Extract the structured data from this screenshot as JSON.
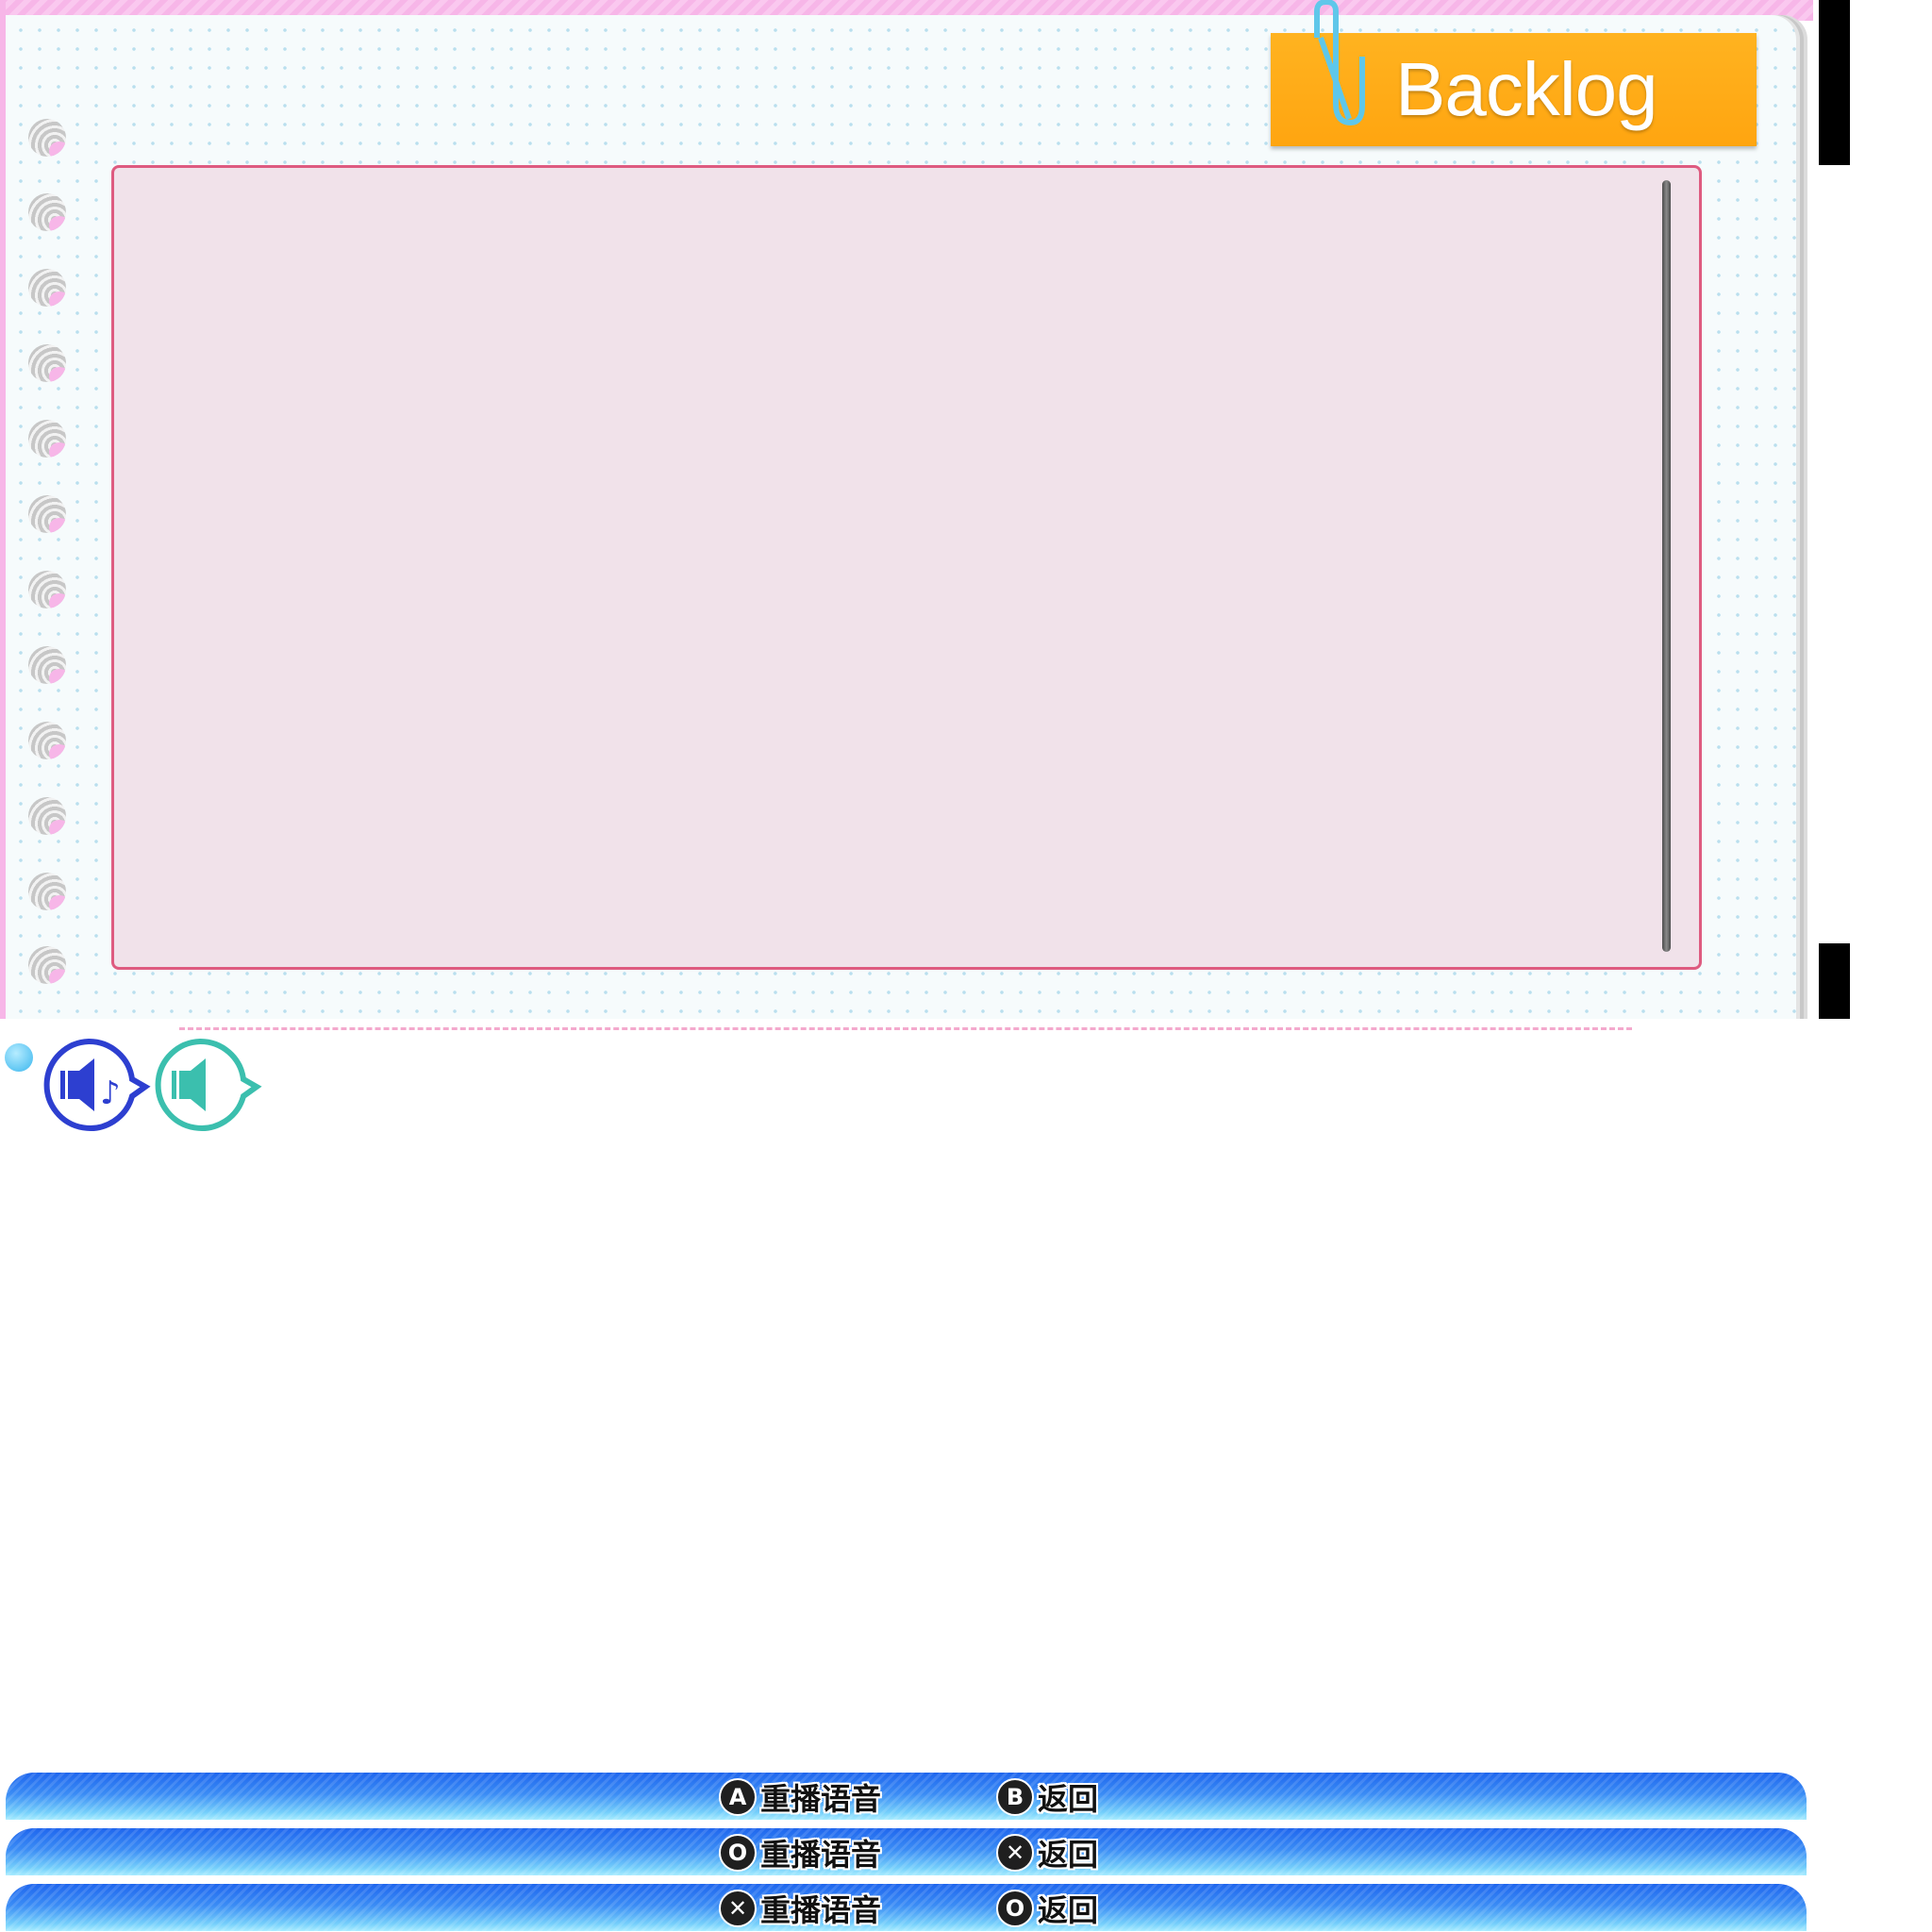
{
  "window": {
    "title": "Backlog"
  },
  "log": {
    "entries": []
  },
  "voice_buttons": [
    {
      "icon": "speaker-music-icon",
      "color": "#2d3fd0"
    },
    {
      "icon": "speaker-icon",
      "color": "#3bbfae"
    }
  ],
  "controls": [
    {
      "confirm_glyph": "A",
      "confirm_label": "重播语音",
      "back_glyph": "B",
      "back_label": "返回"
    },
    {
      "confirm_glyph": "O",
      "confirm_label": "重播语音",
      "back_glyph": "✕",
      "back_label": "返回"
    },
    {
      "confirm_glyph": "✕",
      "confirm_label": "重播语音",
      "back_glyph": "O",
      "back_label": "返回"
    }
  ],
  "colors": {
    "tag": "#ffab14",
    "panel_bg": "#f1e2ea",
    "panel_border": "#de5b80",
    "bar_gradient_top": "#1f66ee",
    "bar_gradient_bottom": "#a8ecff",
    "stripe": "#f7b6e8"
  }
}
